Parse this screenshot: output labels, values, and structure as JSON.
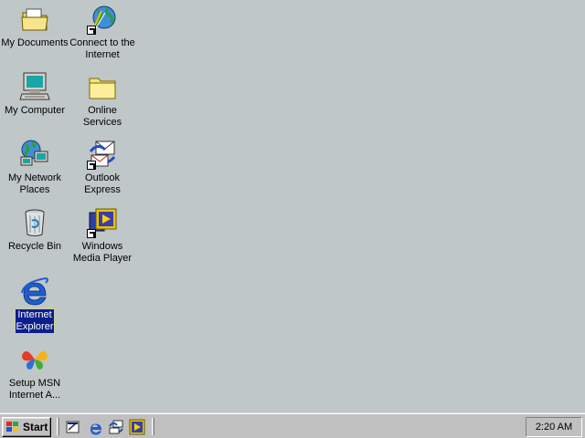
{
  "desktop": {
    "background_color": "#c0c7c8",
    "icons": [
      {
        "label_line1": "My Documents",
        "label_line2": "",
        "icon": "folder-documents-icon",
        "selected": false
      },
      {
        "label_line1": "Connect to the",
        "label_line2": "Internet",
        "icon": "connect-internet-icon",
        "selected": false
      },
      {
        "label_line1": "My Computer",
        "label_line2": "",
        "icon": "computer-icon",
        "selected": false
      },
      {
        "label_line1": "Online",
        "label_line2": "Services",
        "icon": "folder-icon",
        "selected": false
      },
      {
        "label_line1": "My Network",
        "label_line2": "Places",
        "icon": "network-icon",
        "selected": false
      },
      {
        "label_line1": "Outlook",
        "label_line2": "Express",
        "icon": "outlook-express-icon",
        "selected": false
      },
      {
        "label_line1": "Recycle Bin",
        "label_line2": "",
        "icon": "recycle-bin-icon",
        "selected": false
      },
      {
        "label_line1": "Windows",
        "label_line2": "Media Player",
        "icon": "media-player-icon",
        "selected": false
      },
      {
        "label_line1": "Internet",
        "label_line2": "Explorer",
        "icon": "internet-explorer-icon",
        "selected": true
      },
      {
        "label_line1": "Setup MSN",
        "label_line2": "Internet A...",
        "icon": "msn-butterfly-icon",
        "selected": false
      }
    ]
  },
  "taskbar": {
    "start_label": "Start",
    "clock": "2:20 AM",
    "quick_launch": [
      "show-desktop-icon",
      "internet-explorer-icon",
      "outlook-express-icon",
      "media-player-icon"
    ]
  }
}
